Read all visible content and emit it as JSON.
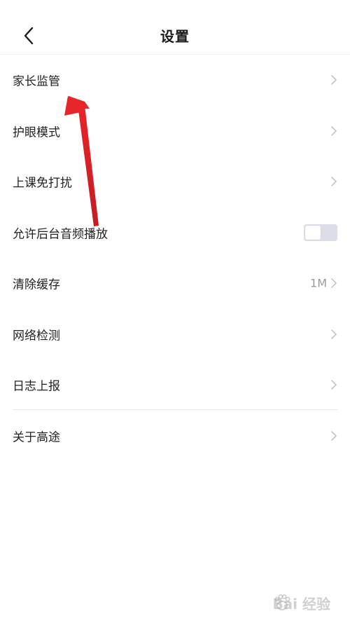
{
  "header": {
    "title": "设置",
    "back_icon": "chevron-left-icon"
  },
  "rows": [
    {
      "label": "家长监管",
      "trailing": "chevron"
    },
    {
      "label": "护眼模式",
      "trailing": "chevron"
    },
    {
      "label": "上课免打扰",
      "trailing": "chevron"
    },
    {
      "label": "允许后台音频播放",
      "trailing": "toggle",
      "toggle_on": false
    },
    {
      "label": "清除缓存",
      "trailing": "chevron",
      "value": "1M"
    },
    {
      "label": "网络检测",
      "trailing": "chevron"
    },
    {
      "label": "日志上报",
      "trailing": "chevron"
    },
    {
      "label": "关于高途",
      "trailing": "chevron"
    }
  ],
  "overlay": {
    "arrow_color": "#e8252a",
    "arrow_target": "家长监管"
  },
  "watermark": {
    "text": "Bai 经验",
    "icon": "paw-icon"
  },
  "colors": {
    "background": "#ffffff",
    "text": "#222222",
    "chevron": "#c4c4c4",
    "toggle_off": "#dcdde6",
    "divider": "#e6e6e6"
  }
}
